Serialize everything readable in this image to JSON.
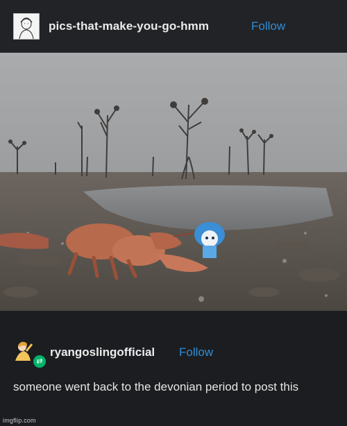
{
  "post": {
    "username": "pics-that-make-you-go-hmm",
    "follow_label": "Follow",
    "avatar_icon": "sketch-portrait-avatar-icon"
  },
  "reply": {
    "username": "ryangoslingofficial",
    "follow_label": "Follow",
    "avatar_icon": "anime-character-avatar-icon",
    "badge_icon": "reblog-icon",
    "text": "someone went back to the devonian period to post this"
  },
  "watermark": "imgflip.com",
  "colors": {
    "link": "#2f8fd8",
    "background": "#1e1f22",
    "badge": "#00b36b"
  }
}
